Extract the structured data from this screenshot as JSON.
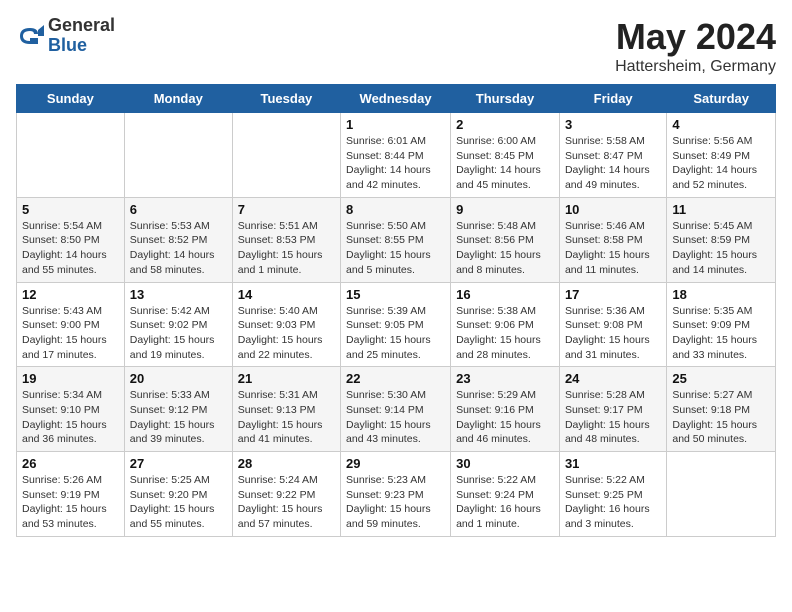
{
  "logo": {
    "general": "General",
    "blue": "Blue"
  },
  "title": "May 2024",
  "location": "Hattersheim, Germany",
  "headers": [
    "Sunday",
    "Monday",
    "Tuesday",
    "Wednesday",
    "Thursday",
    "Friday",
    "Saturday"
  ],
  "weeks": [
    [
      {
        "day": "",
        "info": ""
      },
      {
        "day": "",
        "info": ""
      },
      {
        "day": "",
        "info": ""
      },
      {
        "day": "1",
        "info": "Sunrise: 6:01 AM\nSunset: 8:44 PM\nDaylight: 14 hours\nand 42 minutes."
      },
      {
        "day": "2",
        "info": "Sunrise: 6:00 AM\nSunset: 8:45 PM\nDaylight: 14 hours\nand 45 minutes."
      },
      {
        "day": "3",
        "info": "Sunrise: 5:58 AM\nSunset: 8:47 PM\nDaylight: 14 hours\nand 49 minutes."
      },
      {
        "day": "4",
        "info": "Sunrise: 5:56 AM\nSunset: 8:49 PM\nDaylight: 14 hours\nand 52 minutes."
      }
    ],
    [
      {
        "day": "5",
        "info": "Sunrise: 5:54 AM\nSunset: 8:50 PM\nDaylight: 14 hours\nand 55 minutes."
      },
      {
        "day": "6",
        "info": "Sunrise: 5:53 AM\nSunset: 8:52 PM\nDaylight: 14 hours\nand 58 minutes."
      },
      {
        "day": "7",
        "info": "Sunrise: 5:51 AM\nSunset: 8:53 PM\nDaylight: 15 hours\nand 1 minute."
      },
      {
        "day": "8",
        "info": "Sunrise: 5:50 AM\nSunset: 8:55 PM\nDaylight: 15 hours\nand 5 minutes."
      },
      {
        "day": "9",
        "info": "Sunrise: 5:48 AM\nSunset: 8:56 PM\nDaylight: 15 hours\nand 8 minutes."
      },
      {
        "day": "10",
        "info": "Sunrise: 5:46 AM\nSunset: 8:58 PM\nDaylight: 15 hours\nand 11 minutes."
      },
      {
        "day": "11",
        "info": "Sunrise: 5:45 AM\nSunset: 8:59 PM\nDaylight: 15 hours\nand 14 minutes."
      }
    ],
    [
      {
        "day": "12",
        "info": "Sunrise: 5:43 AM\nSunset: 9:00 PM\nDaylight: 15 hours\nand 17 minutes."
      },
      {
        "day": "13",
        "info": "Sunrise: 5:42 AM\nSunset: 9:02 PM\nDaylight: 15 hours\nand 19 minutes."
      },
      {
        "day": "14",
        "info": "Sunrise: 5:40 AM\nSunset: 9:03 PM\nDaylight: 15 hours\nand 22 minutes."
      },
      {
        "day": "15",
        "info": "Sunrise: 5:39 AM\nSunset: 9:05 PM\nDaylight: 15 hours\nand 25 minutes."
      },
      {
        "day": "16",
        "info": "Sunrise: 5:38 AM\nSunset: 9:06 PM\nDaylight: 15 hours\nand 28 minutes."
      },
      {
        "day": "17",
        "info": "Sunrise: 5:36 AM\nSunset: 9:08 PM\nDaylight: 15 hours\nand 31 minutes."
      },
      {
        "day": "18",
        "info": "Sunrise: 5:35 AM\nSunset: 9:09 PM\nDaylight: 15 hours\nand 33 minutes."
      }
    ],
    [
      {
        "day": "19",
        "info": "Sunrise: 5:34 AM\nSunset: 9:10 PM\nDaylight: 15 hours\nand 36 minutes."
      },
      {
        "day": "20",
        "info": "Sunrise: 5:33 AM\nSunset: 9:12 PM\nDaylight: 15 hours\nand 39 minutes."
      },
      {
        "day": "21",
        "info": "Sunrise: 5:31 AM\nSunset: 9:13 PM\nDaylight: 15 hours\nand 41 minutes."
      },
      {
        "day": "22",
        "info": "Sunrise: 5:30 AM\nSunset: 9:14 PM\nDaylight: 15 hours\nand 43 minutes."
      },
      {
        "day": "23",
        "info": "Sunrise: 5:29 AM\nSunset: 9:16 PM\nDaylight: 15 hours\nand 46 minutes."
      },
      {
        "day": "24",
        "info": "Sunrise: 5:28 AM\nSunset: 9:17 PM\nDaylight: 15 hours\nand 48 minutes."
      },
      {
        "day": "25",
        "info": "Sunrise: 5:27 AM\nSunset: 9:18 PM\nDaylight: 15 hours\nand 50 minutes."
      }
    ],
    [
      {
        "day": "26",
        "info": "Sunrise: 5:26 AM\nSunset: 9:19 PM\nDaylight: 15 hours\nand 53 minutes."
      },
      {
        "day": "27",
        "info": "Sunrise: 5:25 AM\nSunset: 9:20 PM\nDaylight: 15 hours\nand 55 minutes."
      },
      {
        "day": "28",
        "info": "Sunrise: 5:24 AM\nSunset: 9:22 PM\nDaylight: 15 hours\nand 57 minutes."
      },
      {
        "day": "29",
        "info": "Sunrise: 5:23 AM\nSunset: 9:23 PM\nDaylight: 15 hours\nand 59 minutes."
      },
      {
        "day": "30",
        "info": "Sunrise: 5:22 AM\nSunset: 9:24 PM\nDaylight: 16 hours\nand 1 minute."
      },
      {
        "day": "31",
        "info": "Sunrise: 5:22 AM\nSunset: 9:25 PM\nDaylight: 16 hours\nand 3 minutes."
      },
      {
        "day": "",
        "info": ""
      }
    ]
  ]
}
